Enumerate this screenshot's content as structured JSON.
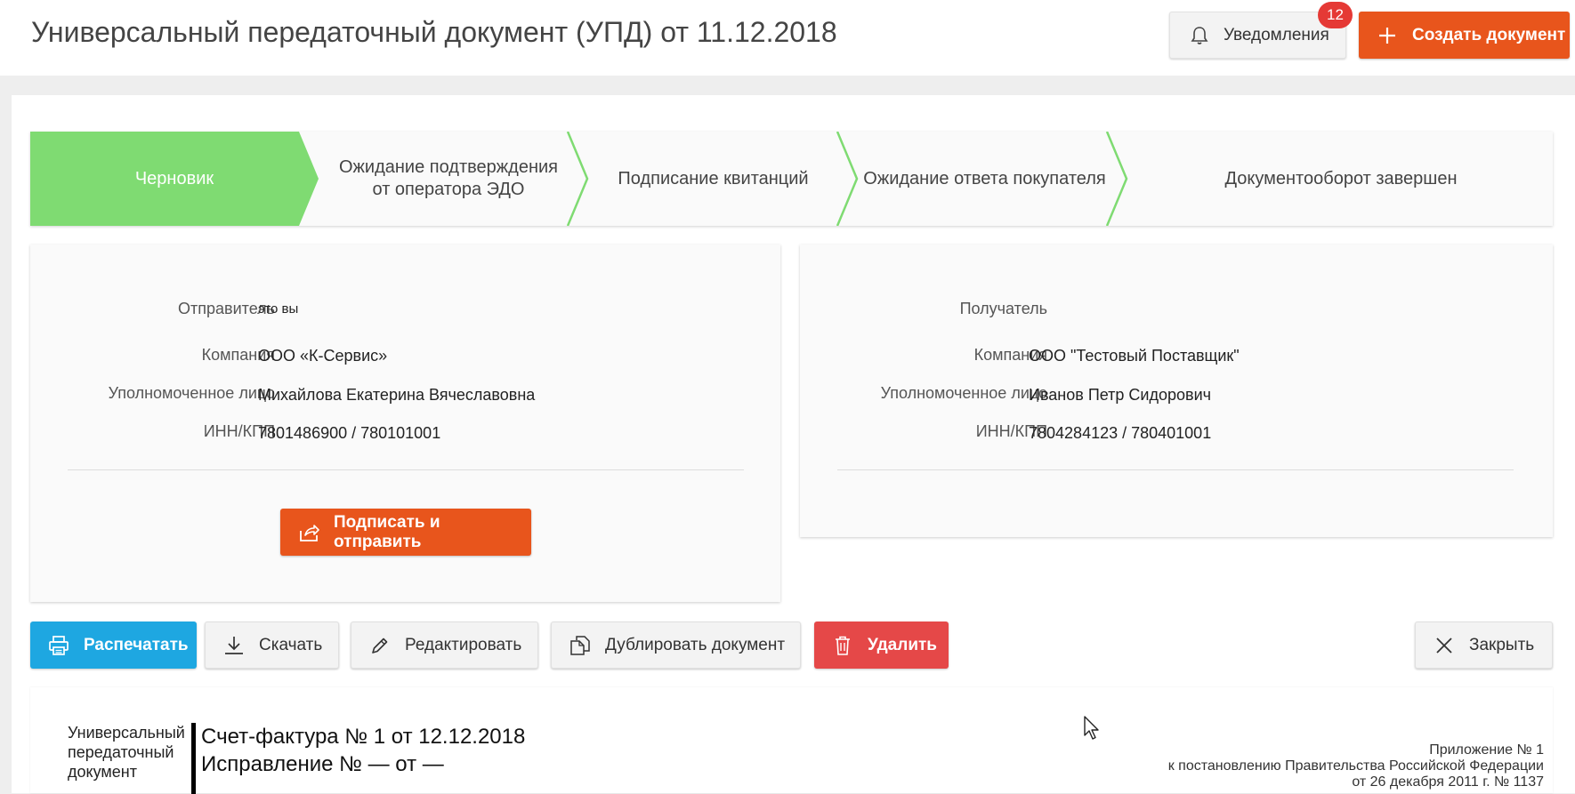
{
  "header": {
    "title": "Универсальный передаточный документ (УПД) от 11.12.2018",
    "notifications_label": "Уведомления",
    "notifications_count": "12",
    "create_label": "Создать документ"
  },
  "stepper": {
    "steps": [
      {
        "label": "Черновик",
        "active": true
      },
      {
        "label": "Ожидание подтверждения от оператора ЭДО",
        "active": false
      },
      {
        "label": "Подписание квитанций",
        "active": false
      },
      {
        "label": "Ожидание ответа покупателя",
        "active": false
      },
      {
        "label": "Документооборот завершен",
        "active": false
      }
    ]
  },
  "sender": {
    "heading_label": "Отправитель",
    "heading_value": "это вы",
    "company_label": "Компания",
    "company": "ООО «К-Сервис»",
    "person_label": "Уполномоченное лицо",
    "person": "Михайлова Екатерина Вячеславовна",
    "inn_label": "ИНН/КПП",
    "inn": "7801486900 / 780101001",
    "sign_label": "Подписать и отправить"
  },
  "recipient": {
    "heading_label": "Получатель",
    "company_label": "Компания",
    "company": "ООО \"Тестовый Поставщик\"",
    "person_label": "Уполномоченное лицо",
    "person": "Иванов Петр Сидорович",
    "inn_label": "ИНН/КПП",
    "inn": "7804284123 / 780401001"
  },
  "actions": {
    "print": "Распечатать",
    "download": "Скачать",
    "edit": "Редактировать",
    "duplicate": "Дублировать документ",
    "delete": "Удалить",
    "close": "Закрыть"
  },
  "document": {
    "type_line1": "Универсальный",
    "type_line2": "передаточный",
    "type_line3": "документ",
    "invoice_line": "Счет-фактура № 1 от 12.12.2018",
    "correction_line": "Исправление №  — от —",
    "appendix_line1": "Приложение № 1",
    "appendix_line2": "к постановлению Правительства Российской Федерации",
    "appendix_line3": "от 26 декабря 2011 г. № 1137"
  },
  "colors": {
    "accent_orange": "#e8551c",
    "step_active_green": "#7fdb72",
    "print_blue": "#1ea7e1",
    "delete_red": "#e54848",
    "badge_red": "#e53935"
  },
  "icons": {
    "notifications": "bell-icon",
    "create": "plus-icon",
    "sign": "share-icon",
    "print": "printer-icon",
    "download": "download-icon",
    "edit": "pencil-icon",
    "duplicate": "copy-icon",
    "delete": "trash-icon",
    "close": "close-icon"
  }
}
